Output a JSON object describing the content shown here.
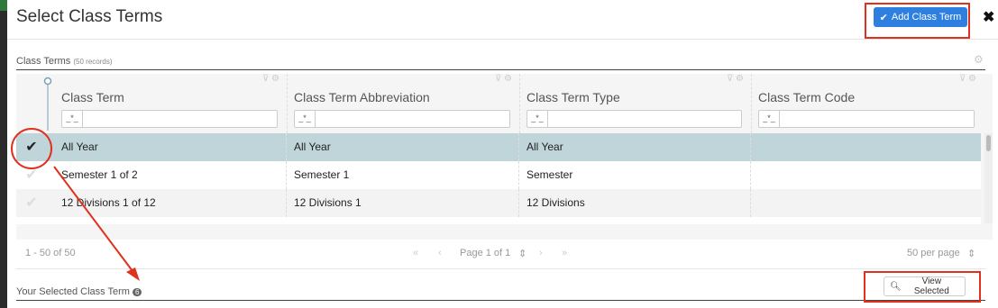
{
  "modal": {
    "title": "Select Class Terms",
    "add_button": "Add Class Term"
  },
  "grid_section": {
    "label": "Class Terms",
    "records": "(50 records)"
  },
  "columns": [
    {
      "label": "Class Term",
      "filter_op": "_*_"
    },
    {
      "label": "Class Term Abbreviation",
      "filter_op": "_*_"
    },
    {
      "label": "Class Term Type",
      "filter_op": "_*_"
    },
    {
      "label": "Class Term Code",
      "filter_op": "_*_"
    }
  ],
  "rows": [
    {
      "cells": [
        "All Year",
        "All Year",
        "All Year",
        ""
      ],
      "selected": true
    },
    {
      "cells": [
        "Semester 1 of 2",
        "Semester 1",
        "Semester",
        ""
      ],
      "selected": false
    },
    {
      "cells": [
        "12 Divisions 1 of 12",
        "12 Divisions 1",
        "12 Divisions",
        ""
      ],
      "selected": false
    }
  ],
  "pager": {
    "range": "1 - 50 of 50",
    "page": "Page 1 of 1",
    "per_page": "50 per page"
  },
  "selected_section": {
    "label": "Your Selected Class Term",
    "count": "6",
    "view_button": "View Selected"
  },
  "colors": {
    "primary": "#2f7fe0",
    "selected_row": "#c0d5da",
    "annotation": "#e0301e"
  }
}
